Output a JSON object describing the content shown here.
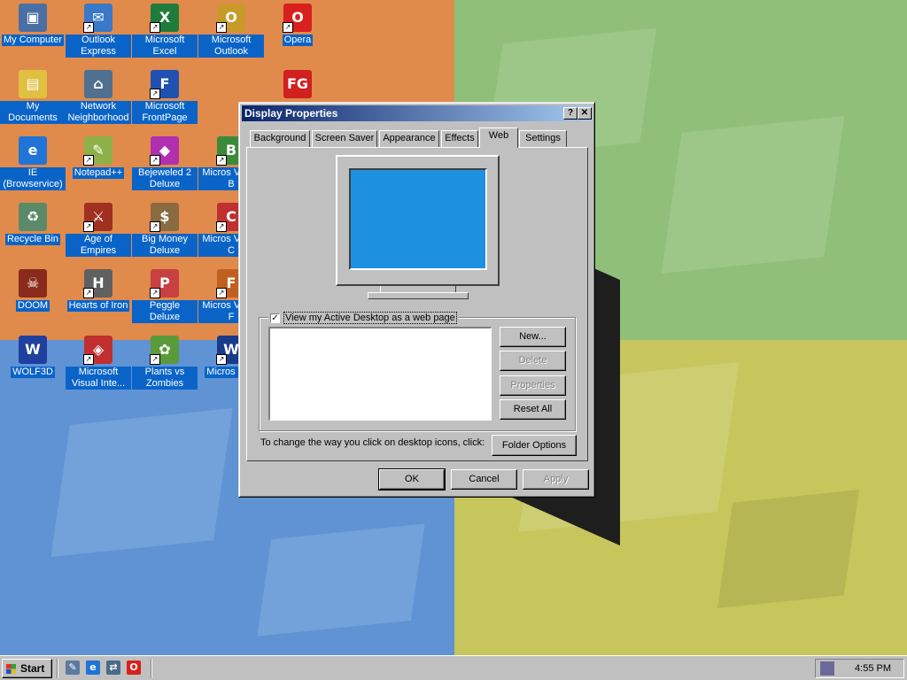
{
  "desktop": {
    "icons": [
      {
        "label": "My Computer",
        "glyph": "▣",
        "color": "#4a6fa5",
        "shortcut": false
      },
      {
        "label": "Outlook Express",
        "glyph": "✉",
        "color": "#3a78c8",
        "shortcut": true
      },
      {
        "label": "Microsoft Excel",
        "glyph": "X",
        "color": "#1e7b3c",
        "shortcut": true
      },
      {
        "label": "Microsoft Outlook",
        "glyph": "O",
        "color": "#c89a2a",
        "shortcut": true
      },
      {
        "label": "Opera",
        "glyph": "O",
        "color": "#d8201c",
        "shortcut": true
      },
      {
        "label": "My Documents",
        "glyph": "▤",
        "color": "#e0c040",
        "shortcut": false
      },
      {
        "label": "Network Neighborhood",
        "glyph": "⌂",
        "color": "#507090",
        "shortcut": false
      },
      {
        "label": "Microsoft FrontPage",
        "glyph": "F",
        "color": "#2050b0",
        "shortcut": true
      },
      {
        "label": "FG",
        "glyph": "FG",
        "color": "#d02020",
        "shortcut": false
      },
      {
        "label": "IE (Browservice)",
        "glyph": "e",
        "color": "#1f74d6",
        "shortcut": false
      },
      {
        "label": "Notepad++",
        "glyph": "✎",
        "color": "#8fb048",
        "shortcut": true
      },
      {
        "label": "Bejeweled 2 Deluxe",
        "glyph": "◆",
        "color": "#b030b0",
        "shortcut": true
      },
      {
        "label": "Micros Visual B",
        "glyph": "B",
        "color": "#3a8a3a",
        "shortcut": true
      },
      {
        "label": "Recycle Bin",
        "glyph": "♻",
        "color": "#5a8a6a",
        "shortcut": false
      },
      {
        "label": "Age of Empires",
        "glyph": "⚔",
        "color": "#a03020",
        "shortcut": true
      },
      {
        "label": "Big Money Deluxe",
        "glyph": "$",
        "color": "#8a6a40",
        "shortcut": true
      },
      {
        "label": "Micros Visual C",
        "glyph": "C",
        "color": "#c03030",
        "shortcut": true
      },
      {
        "label": "DOOM",
        "glyph": "☠",
        "color": "#8a2a1a",
        "shortcut": false
      },
      {
        "label": "Hearts of Iron",
        "glyph": "H",
        "color": "#606060",
        "shortcut": true
      },
      {
        "label": "Peggle Deluxe",
        "glyph": "P",
        "color": "#c84040",
        "shortcut": true
      },
      {
        "label": "Micros Visual F",
        "glyph": "F",
        "color": "#c06020",
        "shortcut": true
      },
      {
        "label": "WOLF3D",
        "glyph": "W",
        "color": "#2040a0",
        "shortcut": false
      },
      {
        "label": "Microsoft Visual Inte...",
        "glyph": "◈",
        "color": "#c03030",
        "shortcut": true
      },
      {
        "label": "Plants vs Zombies",
        "glyph": "✿",
        "color": "#5a9a3a",
        "shortcut": true
      },
      {
        "label": "Micros Wor",
        "glyph": "W",
        "color": "#1a3a8a",
        "shortcut": true
      }
    ]
  },
  "dialog": {
    "title": "Display Properties",
    "help_btn": "?",
    "close_btn": "✕",
    "tabs": [
      "Background",
      "Screen Saver",
      "Appearance",
      "Effects",
      "Web",
      "Settings"
    ],
    "active_tab": "Web",
    "checkbox_label": "View my Active Desktop as a web page",
    "checkbox_checked": "✓",
    "buttons": {
      "new": "New...",
      "delete": "Delete",
      "properties": "Properties",
      "reset_all": "Reset All",
      "folder_options": "Folder Options",
      "ok": "OK",
      "cancel": "Cancel",
      "apply": "Apply"
    },
    "hint": "To change the way you click on desktop icons, click:",
    "colors": {
      "title_start": "#0a246a",
      "title_end": "#a6caf0",
      "monitor_screen": "#1e90e0",
      "face": "#c0c0c0"
    }
  },
  "taskbar": {
    "start_label": "Start",
    "quick_launch": [
      {
        "name": "show-desktop-icon",
        "glyph": "✎",
        "color": "#5a7aa0"
      },
      {
        "name": "ie-icon",
        "glyph": "e",
        "color": "#1f74d6"
      },
      {
        "name": "network-icon",
        "glyph": "⇄",
        "color": "#4a6a8a"
      },
      {
        "name": "opera-icon",
        "glyph": "O",
        "color": "#d8201c"
      }
    ],
    "clock": "4:55 PM"
  }
}
